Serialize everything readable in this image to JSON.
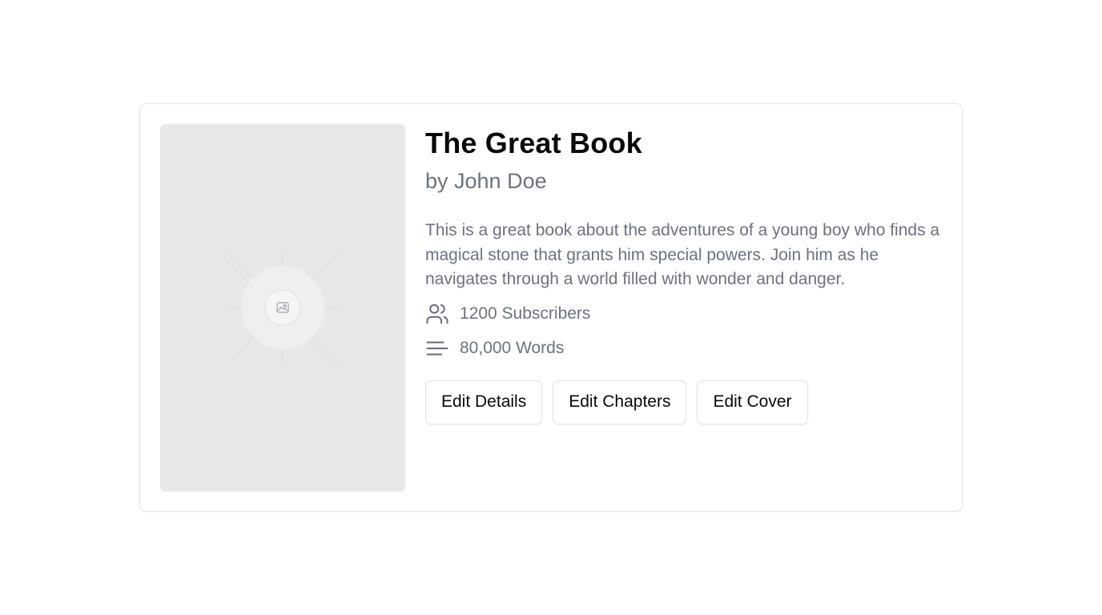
{
  "book": {
    "title": "The Great Book",
    "author": "by John Doe",
    "description": "This is a great book about the adventures of a young boy who finds a magical stone that grants him special powers. Join him as he navigates through a world filled with wonder and danger.",
    "cover_icon": "image-placeholder-icon"
  },
  "stats": {
    "subscribers": {
      "icon": "users-icon",
      "label": "1200 Subscribers"
    },
    "words": {
      "icon": "text-lines-icon",
      "label": "80,000 Words"
    }
  },
  "actions": {
    "edit_details": "Edit Details",
    "edit_chapters": "Edit Chapters",
    "edit_cover": "Edit Cover"
  },
  "colors": {
    "muted_text": "#6b7280",
    "border": "#e4e4e7",
    "cover_bg": "#e8e8e8"
  }
}
